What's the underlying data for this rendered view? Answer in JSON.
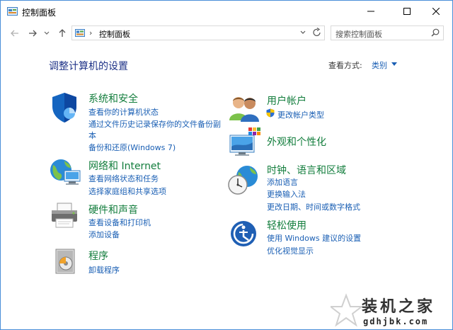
{
  "window": {
    "title": "控制面板"
  },
  "address": {
    "separator": "›",
    "breadcrumb": "控制面板"
  },
  "search": {
    "placeholder": "搜索控制面板"
  },
  "main": {
    "heading": "调整计算机的设置",
    "view_by_label": "查看方式:",
    "view_by_value": "类别"
  },
  "categories": {
    "system": {
      "title": "系统和安全",
      "links": [
        "查看你的计算机状态",
        "通过文件历史记录保存你的文件备份副",
        "本",
        "备份和还原(Windows 7)"
      ]
    },
    "network": {
      "title": "网络和 Internet",
      "links": [
        "查看网络状态和任务",
        "选择家庭组和共享选项"
      ]
    },
    "hardware": {
      "title": "硬件和声音",
      "links": [
        "查看设备和打印机",
        "添加设备"
      ]
    },
    "programs": {
      "title": "程序",
      "links": [
        "卸载程序"
      ]
    },
    "accounts": {
      "title": "用户帐户",
      "links": [
        "更改帐户类型"
      ]
    },
    "appearance": {
      "title": "外观和个性化",
      "links": []
    },
    "clock": {
      "title": "时钟、语言和区域",
      "links": [
        "添加语言",
        "更换输入法",
        "更改日期、时间或数字格式"
      ]
    },
    "ease": {
      "title": "轻松使用",
      "links": [
        "使用 Windows 建议的设置",
        "优化视觉显示"
      ]
    }
  },
  "watermark": {
    "text": "装机之家",
    "url": "gdhjbk.com"
  },
  "colors": {
    "link": "#1a5fb4",
    "category_title": "#127d3c",
    "heading": "#1e3287",
    "border": "#4a8fd8"
  }
}
